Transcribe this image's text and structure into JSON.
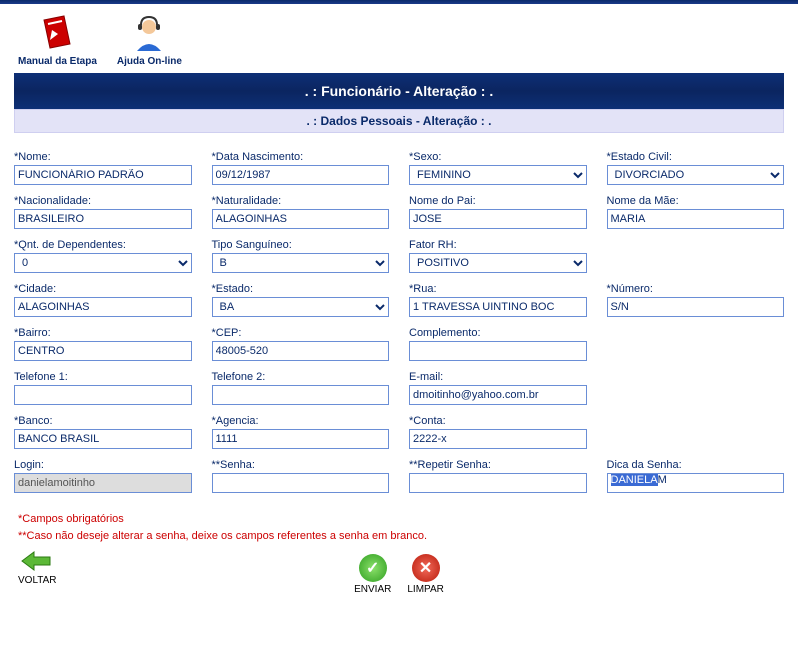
{
  "header": {
    "manual_label": "Manual da Etapa",
    "ajuda_label": "Ajuda On-line"
  },
  "titles": {
    "main": ". : Funcionário - Alteração : .",
    "sub": ". : Dados Pessoais - Alteração : ."
  },
  "labels": {
    "nome": "*Nome:",
    "data_nasc": "*Data Nascimento:",
    "sexo": "*Sexo:",
    "estado_civil": "*Estado Civil:",
    "nacionalidade": "*Nacionalidade:",
    "naturalidade": "*Naturalidade:",
    "nome_pai": "Nome do Pai:",
    "nome_mae": "Nome da Mãe:",
    "dependentes": "*Qnt. de Dependentes:",
    "tipo_sang": "Tipo Sanguíneo:",
    "fator_rh": "Fator RH:",
    "cidade": "*Cidade:",
    "estado": "*Estado:",
    "rua": "*Rua:",
    "numero": "*Número:",
    "bairro": "*Bairro:",
    "cep": "*CEP:",
    "complemento": "Complemento:",
    "tel1": "Telefone 1:",
    "tel2": "Telefone 2:",
    "email": "E-mail:",
    "banco": "*Banco:",
    "agencia": "*Agencia:",
    "conta": "*Conta:",
    "login": "Login:",
    "senha": "**Senha:",
    "repetir_senha": "**Repetir Senha:",
    "dica": "Dica da Senha:"
  },
  "values": {
    "nome": "FUNCIONÁRIO PADRÃO",
    "data_nasc": "09/12/1987",
    "sexo": "FEMININO",
    "estado_civil": "DIVORCIADO",
    "nacionalidade": "BRASILEIRO",
    "naturalidade": "ALAGOINHAS",
    "nome_pai": "JOSE",
    "nome_mae": "MARIA",
    "dependentes": "0",
    "tipo_sang": "B",
    "fator_rh": "POSITIVO",
    "cidade": "ALAGOINHAS",
    "estado": "BA",
    "rua": "1 TRAVESSA UINTINO BOC",
    "numero": "S/N",
    "bairro": "CENTRO",
    "cep": "48005-520",
    "complemento": "",
    "tel1": "",
    "tel2": "",
    "email": "dmoitinho@yahoo.com.br",
    "banco": "BANCO BRASIL",
    "agencia": "1111",
    "conta": "2222-x",
    "login": "danielamoitinho",
    "senha": "",
    "repetir_senha": "",
    "dica_sel": "DANIELA",
    "dica_rest": "M"
  },
  "notes": {
    "line1": "*Campos obrigatórios",
    "line2": "**Caso não deseje alterar a senha, deixe os campos referentes a senha em branco."
  },
  "buttons": {
    "voltar": "VOLTAR",
    "enviar": "ENVIAR",
    "limpar": "LIMPAR"
  }
}
